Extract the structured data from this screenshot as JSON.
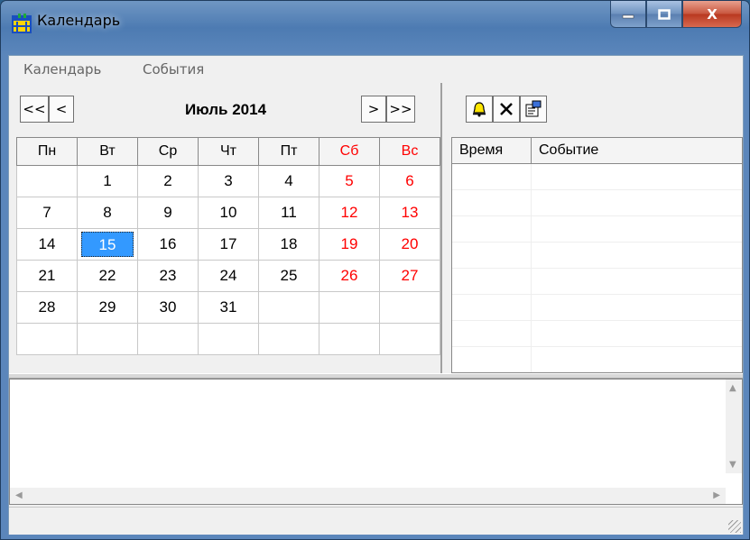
{
  "window": {
    "title": "Календарь",
    "minimize": "‒",
    "maximize": "□",
    "close": "X"
  },
  "menu": {
    "calendar": "Календарь",
    "events": "События"
  },
  "nav": {
    "prev_year": "<<",
    "prev_month": "<",
    "month_label": "Июль 2014",
    "next_month": ">",
    "next_year": ">>"
  },
  "weekdays": [
    "Пн",
    "Вт",
    "Ср",
    "Чт",
    "Пт",
    "Сб",
    "Вс"
  ],
  "weeks": [
    [
      "",
      "1",
      "2",
      "3",
      "4",
      "5",
      "6"
    ],
    [
      "7",
      "8",
      "9",
      "10",
      "11",
      "12",
      "13"
    ],
    [
      "14",
      "15",
      "16",
      "17",
      "18",
      "19",
      "20"
    ],
    [
      "21",
      "22",
      "23",
      "24",
      "25",
      "26",
      "27"
    ],
    [
      "28",
      "29",
      "30",
      "31",
      "",
      "",
      ""
    ],
    [
      "",
      "",
      "",
      "",
      "",
      "",
      ""
    ]
  ],
  "selected_day": "15",
  "toolbar": {
    "alarm": "bell-icon",
    "delete": "delete-icon",
    "properties": "properties-icon"
  },
  "events_table": {
    "col_time": "Время",
    "col_event": "Событие"
  },
  "colors": {
    "weekend": "#ff0000",
    "selection": "#3399ff"
  }
}
